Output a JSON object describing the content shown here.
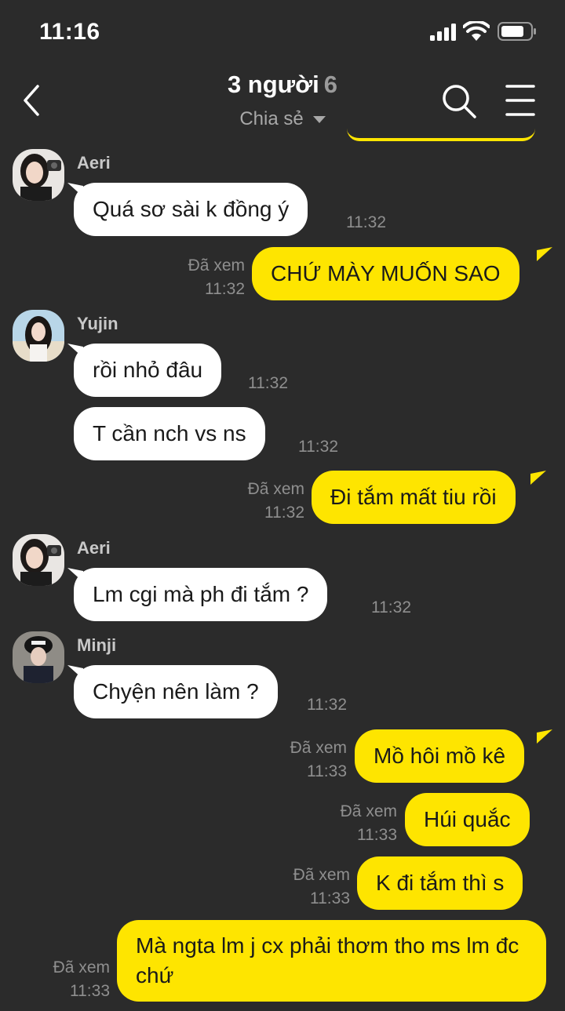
{
  "status_bar": {
    "time": "11:16"
  },
  "header": {
    "title": "3 người",
    "member_count": "6",
    "subtitle": "Chia sẻ"
  },
  "messages": [
    {
      "type": "incoming",
      "sender": "Aeri",
      "text": "Quá sơ sài k đồng ý",
      "time": "11:32"
    },
    {
      "type": "outgoing",
      "read": "Đã xem",
      "time": "11:32",
      "text": "CHỨ MÀY MUỐN SAO"
    },
    {
      "type": "incoming",
      "sender": "Yujin",
      "text": "rồi nhỏ đâu",
      "time": "11:32"
    },
    {
      "type": "incoming",
      "text": "T cần nch vs ns",
      "time": "11:32"
    },
    {
      "type": "outgoing",
      "read": "Đã xem",
      "time": "11:32",
      "text": "Đi tắm mất tiu rồi"
    },
    {
      "type": "incoming",
      "sender": "Aeri",
      "text": "Lm cgi mà ph đi tắm ?",
      "time": "11:32"
    },
    {
      "type": "incoming",
      "sender": "Minji",
      "text": "Chyện nên làm ?",
      "time": "11:32"
    },
    {
      "type": "outgoing",
      "read": "Đã xem",
      "time": "11:33",
      "text": "Mồ hôi mồ kê"
    },
    {
      "type": "outgoing",
      "read": "Đã xem",
      "time": "11:33",
      "text": "Húi quắc"
    },
    {
      "type": "outgoing",
      "read": "Đã xem",
      "time": "11:33",
      "text": "K đi tắm thì s"
    },
    {
      "type": "outgoing",
      "read": "Đã xem",
      "time": "11:33",
      "text": "Mà ngta lm j cx phải thơm tho ms lm đc chứ"
    }
  ],
  "colors": {
    "background": "#2b2b2b",
    "outgoing_bubble": "#fee500",
    "incoming_bubble": "#ffffff"
  }
}
